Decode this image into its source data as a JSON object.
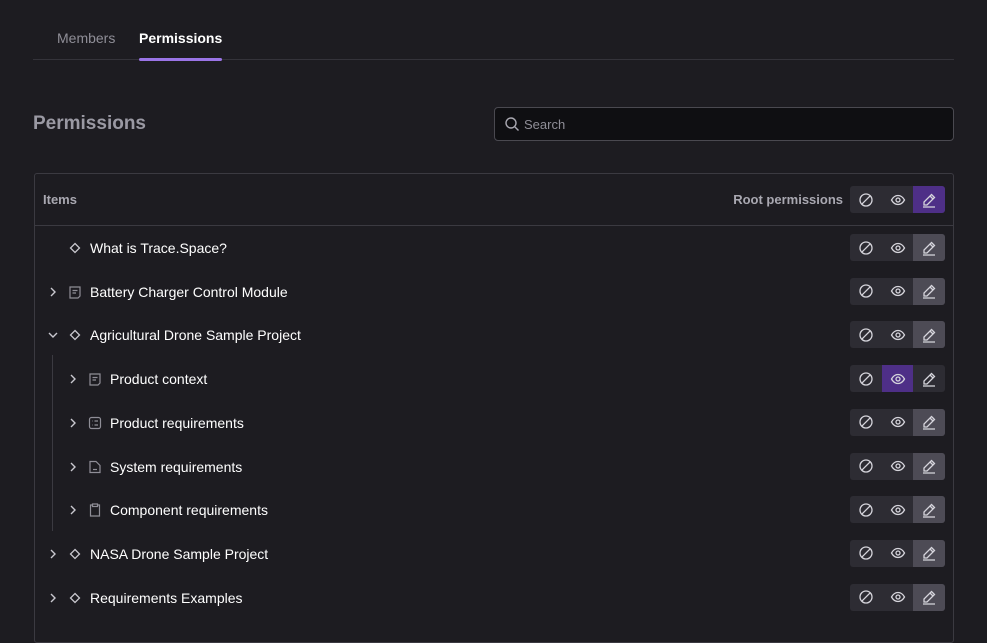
{
  "tabs": {
    "members": "Members",
    "permissions": "Permissions"
  },
  "page_title": "Permissions",
  "search": {
    "placeholder": "Search",
    "value": ""
  },
  "table": {
    "col_items": "Items",
    "col_root": "Root permissions",
    "root_selected": "edit",
    "rows": [
      {
        "label": "What is Trace.Space?",
        "icon": "diamond-icon",
        "level": 0,
        "expand": "none",
        "selected": "edit"
      },
      {
        "label": "Battery Charger Control Module",
        "icon": "document-icon",
        "level": 0,
        "expand": "collapsed",
        "selected": "edit"
      },
      {
        "label": "Agricultural Drone Sample Project",
        "icon": "diamond-icon",
        "level": 0,
        "expand": "expanded",
        "selected": "edit"
      },
      {
        "label": "Product context",
        "icon": "document-icon",
        "level": 1,
        "expand": "collapsed",
        "selected": "view"
      },
      {
        "label": "Product requirements",
        "icon": "list-icon",
        "level": 1,
        "expand": "collapsed",
        "selected": "edit"
      },
      {
        "label": "System requirements",
        "icon": "file-icon",
        "level": 1,
        "expand": "collapsed",
        "selected": "edit"
      },
      {
        "label": "Component requirements",
        "icon": "clipboard-icon",
        "level": 1,
        "expand": "collapsed",
        "selected": "edit"
      },
      {
        "label": "NASA Drone Sample Project",
        "icon": "diamond-icon",
        "level": 0,
        "expand": "collapsed",
        "selected": "edit"
      },
      {
        "label": "Requirements Examples",
        "icon": "diamond-icon",
        "level": 0,
        "expand": "collapsed",
        "selected": "edit"
      }
    ]
  },
  "colors": {
    "accent": "#9a74e6",
    "selected_root": "#4e2f87",
    "background": "#1d1c21"
  }
}
